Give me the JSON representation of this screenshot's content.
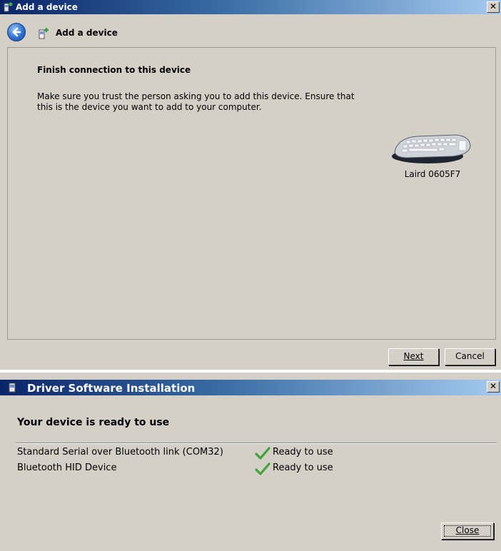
{
  "add_device_window": {
    "title": "Add a device",
    "nav_title": "Add a device",
    "heading": "Finish connection to this device",
    "description": "Make sure you trust the person asking you to add this device. Ensure that this is the device you want to add to your computer.",
    "device": {
      "name": "Laird 0605F7",
      "icon": "keyboard-icon"
    },
    "buttons": {
      "next": "Next",
      "cancel": "Cancel"
    }
  },
  "driver_window": {
    "title": "Driver Software Installation",
    "heading": "Your device is ready to use",
    "devices": [
      {
        "name": "Standard Serial over Bluetooth link (COM32)",
        "status": "Ready to use",
        "status_icon": "green-check-icon"
      },
      {
        "name": "Bluetooth HID Device",
        "status": "Ready to use",
        "status_icon": "green-check-icon"
      }
    ],
    "buttons": {
      "close": "Close"
    }
  },
  "colors": {
    "title_start": "#0a246a",
    "title_end": "#a6caf0",
    "window_bg": "#d4d0c8",
    "check_green": "#3fa53a"
  }
}
